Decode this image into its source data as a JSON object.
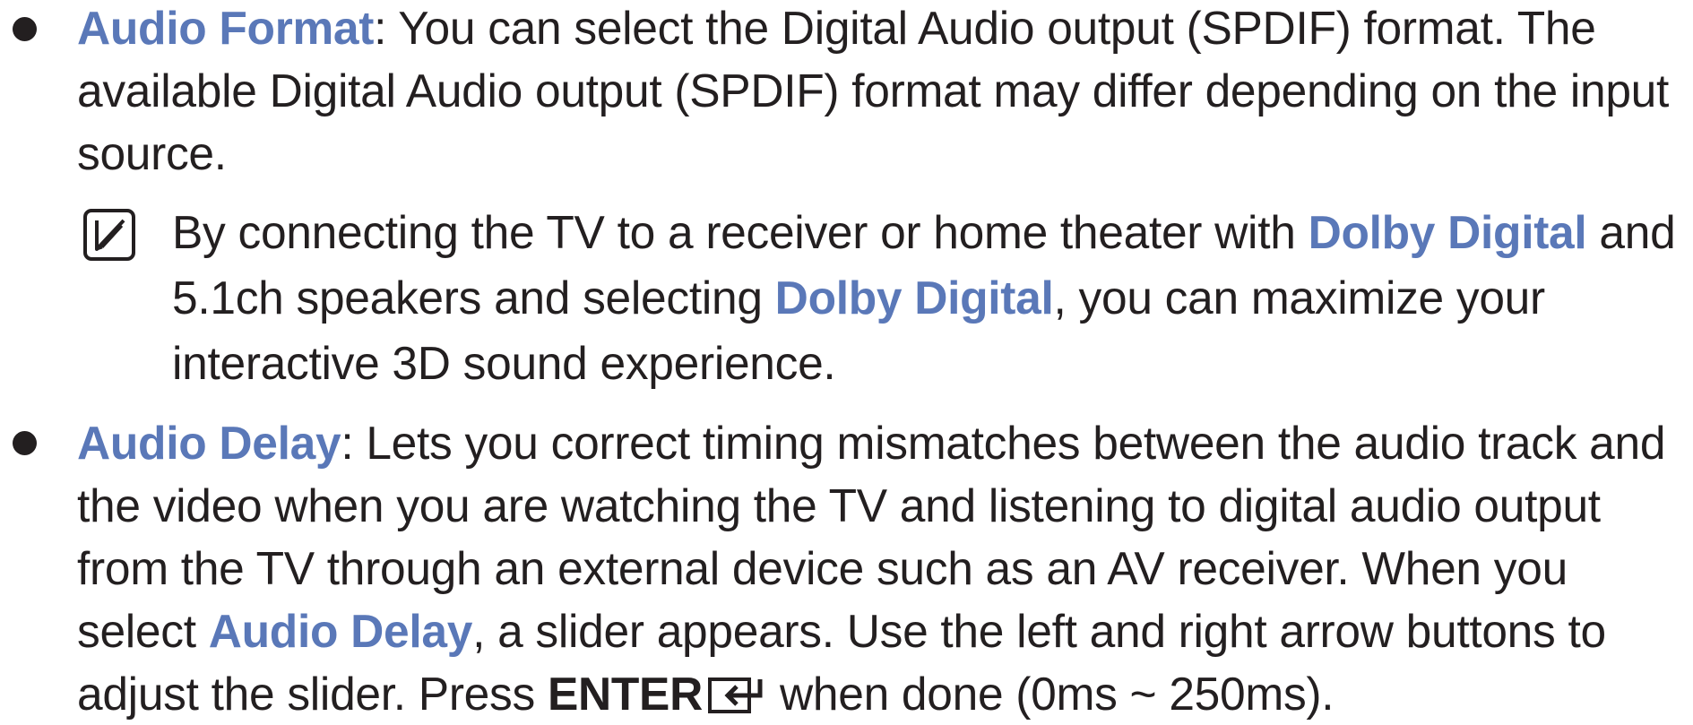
{
  "items": [
    {
      "term": "Audio Format",
      "desc": ": You can select the Digital Audio output (SPDIF) format. The available Digital Audio output (SPDIF) format may differ depending on the input source."
    },
    {
      "term": "Audio Delay",
      "desc1": ": Lets you correct timing mismatches between the audio track and the video when you are watching the TV and listening to digital audio output from the TV through an external device such as an AV receiver. When you select ",
      "term2": "Audio Delay",
      "desc2": ", a slider appears. Use the left and right arrow buttons to adjust the slider. Press ",
      "key": "ENTER",
      "desc3": " when done (0ms ~ 250ms)."
    }
  ],
  "note": {
    "icon": "note-icon",
    "text1": "By connecting the TV to a receiver or home theater with ",
    "term1": "Dolby Digital",
    "text2": " and 5.1ch speakers and selecting ",
    "term2": "Dolby Digital",
    "text3": ", you can maximize your interactive 3D sound experience."
  },
  "colors": {
    "keyword": "#5a78b8",
    "text": "#231f20"
  }
}
